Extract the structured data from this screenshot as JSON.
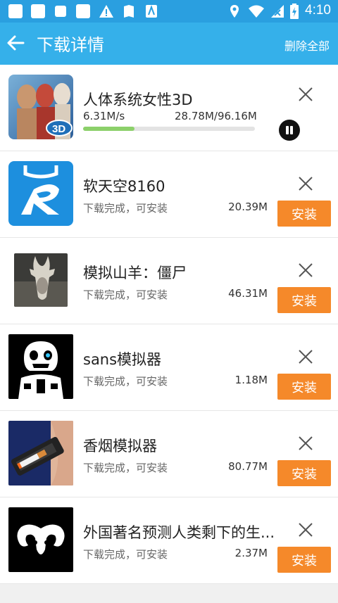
{
  "statusbar": {
    "time": "4:10"
  },
  "appbar": {
    "title": "下载详情",
    "delete_all": "删除全部"
  },
  "downloads": [
    {
      "name": "人体系统女性3D",
      "speed": "6.31M/s",
      "progress_text": "28.78M/96.16M",
      "progress": 0.3
    },
    {
      "name": "软天空8160",
      "status": "下载完成，可安装",
      "size": "20.39M",
      "install": "安装"
    },
    {
      "name": "模拟山羊：僵尸",
      "status": "下载完成，可安装",
      "size": "46.31M",
      "install": "安装"
    },
    {
      "name": "sans模拟器",
      "status": "下载完成，可安装",
      "size": "1.18M",
      "install": "安装"
    },
    {
      "name": "香烟模拟器",
      "status": "下载完成，可安装",
      "size": "80.77M",
      "install": "安装"
    },
    {
      "name": "外国著名预测人类剩下的生...",
      "status": "下载完成，可安装",
      "size": "2.37M",
      "install": "安装"
    }
  ],
  "colors": {
    "appbar": "#35b0ea",
    "install_button": "#f5892a",
    "progress": "#8cd06a"
  },
  "thumb_labels": {
    "anatomy": "3D"
  }
}
